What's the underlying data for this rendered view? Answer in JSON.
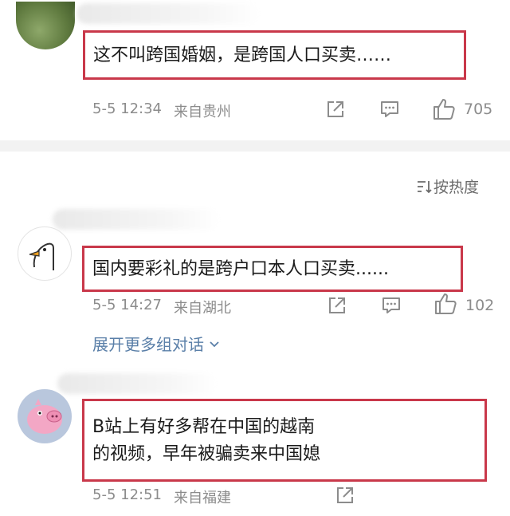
{
  "comments": [
    {
      "text_line1": "这不叫跨国婚姻，是跨国人口买卖……",
      "date": "5-5 12:34",
      "location": "来自贵州",
      "likes": "705"
    },
    {
      "text_line1": "国内要彩礼的是跨户口本人口买卖......",
      "date": "5-5 14:27",
      "location": "来自湖北",
      "likes": "102"
    },
    {
      "text_line1": "B站上有好多帮在中国的越南",
      "text_line2": "的视频，早年被骗卖来中国媳",
      "date": "5-5 12:51",
      "location": "来自福建"
    }
  ],
  "sort_label": "按热度",
  "expand_label": "展开更多组对话",
  "icons": {
    "share": "share-icon",
    "comment": "comment-icon",
    "like": "thumbs-up-icon",
    "sort": "sort-icon",
    "expand": "chevron-down-icon"
  },
  "colors": {
    "highlight_border": "#c9384a",
    "meta_text": "#8c8c8c",
    "link_text": "#5a7fa8"
  }
}
